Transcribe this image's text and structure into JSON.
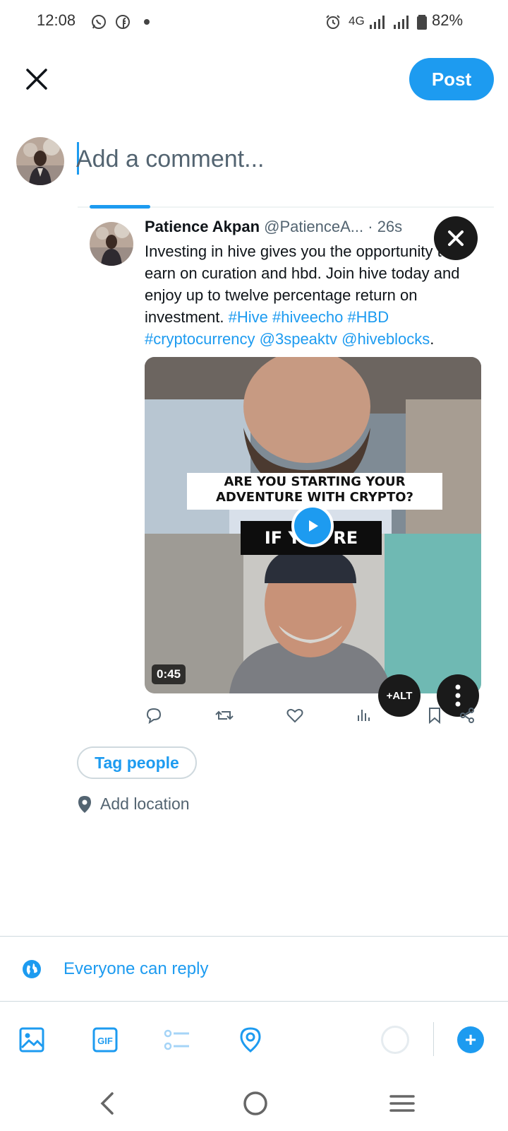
{
  "status_bar": {
    "time": "12:08",
    "network": "4G",
    "battery": "82%",
    "icons_left": [
      "whatsapp-icon",
      "facebook-icon",
      "dot-icon"
    ],
    "icons_right": [
      "alarm-icon",
      "signal-icon",
      "signal-icon",
      "battery-icon"
    ]
  },
  "header": {
    "post_label": "Post"
  },
  "composer": {
    "placeholder": "Add a comment..."
  },
  "quoted_post": {
    "author_name": "Patience Akpan",
    "author_handle": "@PatienceA...",
    "time": "· 26s",
    "text": "Investing in hive gives you the opportunity to earn on curation and hbd. Join hive today and enjoy up to twelve percentage return on investment.",
    "tags": [
      "#Hive",
      "#hiveecho",
      "#HBD",
      "#cryptocurrency",
      "@3speaktv",
      "@hiveblocks"
    ],
    "trailing": ".",
    "video": {
      "caption_top": "ARE YOU STARTING YOUR ADVENTURE WITH CRYPTO?",
      "caption_bottom": "IF YOU'RE",
      "duration": "0:45",
      "alt_label": "+ALT"
    },
    "actions": [
      "reply-icon",
      "repost-icon",
      "like-icon",
      "views-icon",
      "bookmark-icon",
      "share-icon"
    ]
  },
  "tag_people_label": "Tag people",
  "add_location_label": "Add location",
  "reply_setting_label": "Everyone can reply",
  "toolbar": [
    "image-icon",
    "gif-icon",
    "poll-icon",
    "location-icon"
  ],
  "add_label": "+",
  "colors": {
    "accent": "#1d9bf0",
    "text_primary": "#0f1419",
    "text_secondary": "#536471",
    "border": "#cfd9de"
  }
}
